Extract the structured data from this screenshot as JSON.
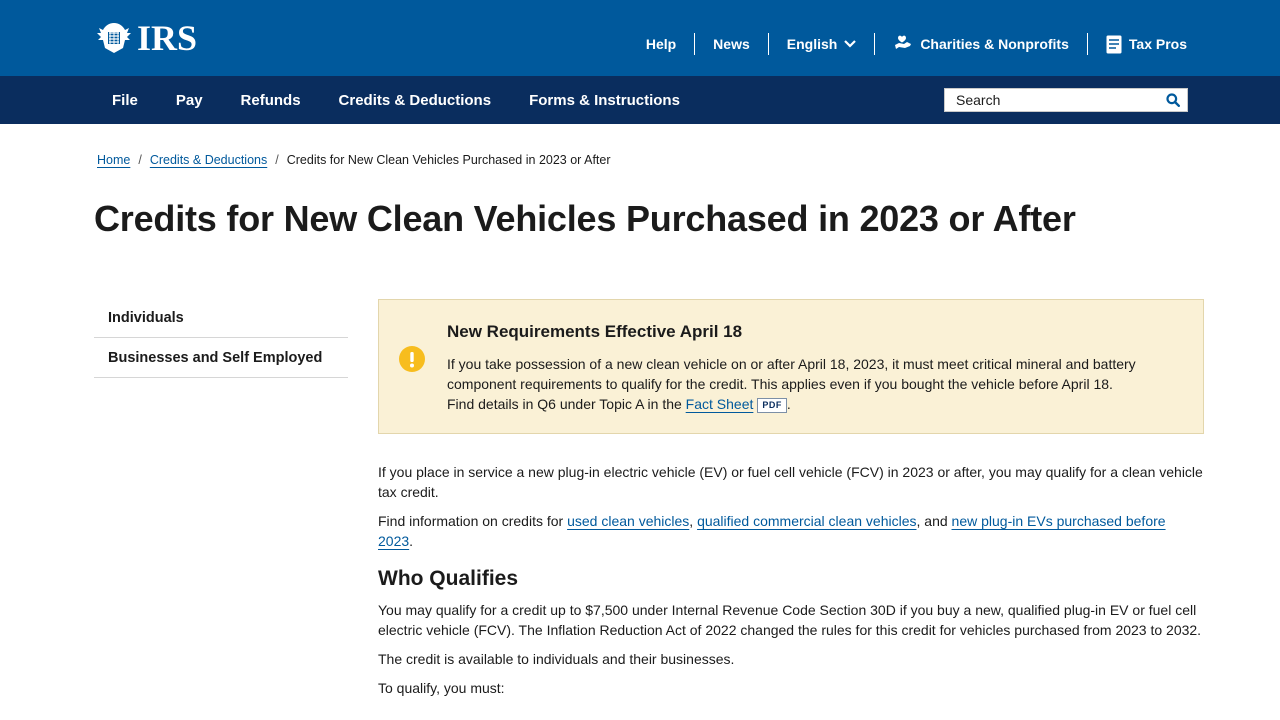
{
  "brand": {
    "logo_text": "IRS"
  },
  "utility_nav": {
    "help": "Help",
    "news": "News",
    "language": "English",
    "charities": "Charities & Nonprofits",
    "tax_pros": "Tax Pros"
  },
  "main_nav": {
    "items": [
      "File",
      "Pay",
      "Refunds",
      "Credits & Deductions",
      "Forms & Instructions"
    ]
  },
  "search": {
    "placeholder": "Search",
    "icon": "search-icon"
  },
  "breadcrumb": {
    "home": "Home",
    "section": "Credits & Deductions",
    "separator": "/",
    "current": "Credits for New Clean Vehicles Purchased in 2023 or After"
  },
  "page_title": "Credits for New Clean Vehicles Purchased in 2023 or After",
  "sidebar": {
    "items": [
      "Individuals",
      "Businesses and Self Employed"
    ]
  },
  "alert": {
    "icon": "exclamation-icon",
    "title": "New Requirements Effective April 18",
    "body": "If you take possession of a new clean vehicle on or after April 18, 2023, it must meet critical mineral and battery component requirements to qualify for the credit. This applies even if you bought the vehicle before April 18. Find details in Q6 under Topic A in the ",
    "link_text": "Fact Sheet",
    "badge": "PDF",
    "end": "."
  },
  "content": {
    "intro": "If you place in service a new plug-in electric vehicle (EV) or fuel cell vehicle (FCV) in 2023 or after, you may qualify for a clean vehicle tax credit.",
    "find_info_prefix": "Find information on credits for ",
    "link_used": "used clean vehicles",
    "comma": ", ",
    "link_commercial": "qualified commercial clean vehicles",
    "and_text": ", and ",
    "link_before": "new plug-in EVs purchased before 2023",
    "period": ".",
    "who_heading": "Who Qualifies",
    "who_body": "You may qualify for a credit up to $7,500 under Internal Revenue Code Section 30D if you buy a new, qualified plug-in EV or fuel cell electric vehicle (FCV). The Inflation Reduction Act of 2022 changed the rules for this credit for vehicles purchased from 2023 to 2032.",
    "available": "The credit is available to individuals and their businesses.",
    "to_qualify": "To qualify, you must:"
  },
  "colors": {
    "top_bar": "#00599c",
    "main_nav": "#0a2d5e",
    "link": "#00599c",
    "alert_bg": "#faf1d6",
    "alert_icon": "#f7bd1e"
  }
}
